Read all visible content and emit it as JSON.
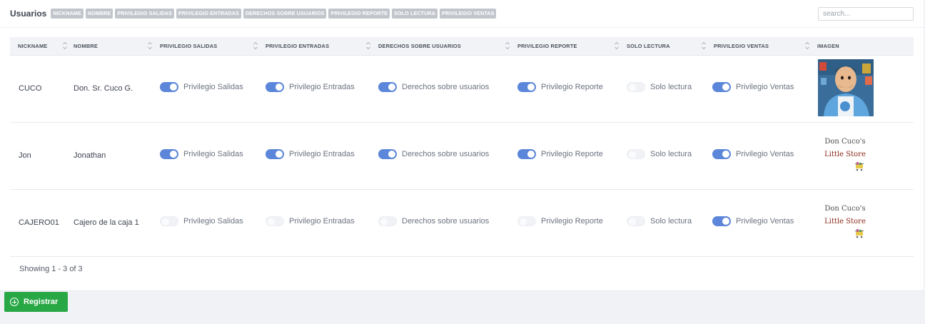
{
  "header": {
    "title": "Usuarios",
    "chips": [
      "NICKNAME",
      "NOMBRE",
      "PRIVILEGIO SALIDAS",
      "PRIVILEGIO ENTRADAS",
      "DERECHOS SOBRE USUARIOS",
      "PRIVILEGIO REPORTE",
      "SOLO LECTURA",
      "PRIVILEGIO VENTAS"
    ]
  },
  "search": {
    "placeholder": "search..."
  },
  "table": {
    "columns": [
      "NICKNAME",
      "NOMBRE",
      "PRIVILEGIO SALIDAS",
      "PRIVILEGIO ENTRADAS",
      "DERECHOS SOBRE USUARIOS",
      "PRIVILEGIO REPORTE",
      "SOLO LECTURA",
      "PRIVILEGIO VENTAS",
      "IMAGEN"
    ],
    "toggle_labels": [
      "Privilegio Salidas",
      "Privilegio Entradas",
      "Derechos sobre usuarios",
      "Privilegio Reporte",
      "Solo lectura",
      "Privilegio Ventas"
    ],
    "rows": [
      {
        "nickname": "CUCO",
        "nombre": "Don. Sr. Cuco G.",
        "toggles": [
          true,
          true,
          true,
          true,
          false,
          true
        ],
        "image": "avatar-photo"
      },
      {
        "nickname": "Jon",
        "nombre": "Jonathan",
        "toggles": [
          true,
          true,
          true,
          true,
          false,
          true
        ],
        "image": "store-logo",
        "logo_line1": "Don Cuco's",
        "logo_line2": "Little Store"
      },
      {
        "nickname": "CAJERO01",
        "nombre": "Cajero de la caja 1",
        "toggles": [
          false,
          false,
          false,
          false,
          false,
          true
        ],
        "image": "store-logo",
        "logo_line1": "Don Cuco's",
        "logo_line2": "Little Store"
      }
    ]
  },
  "footer": {
    "showing": "Showing 1 - 3 of 3"
  },
  "actions": {
    "register_label": "Registrar"
  },
  "colors": {
    "toggle_on": "#5b86d9",
    "register_button": "#28a745",
    "chip_bg": "#c2c6cc"
  }
}
